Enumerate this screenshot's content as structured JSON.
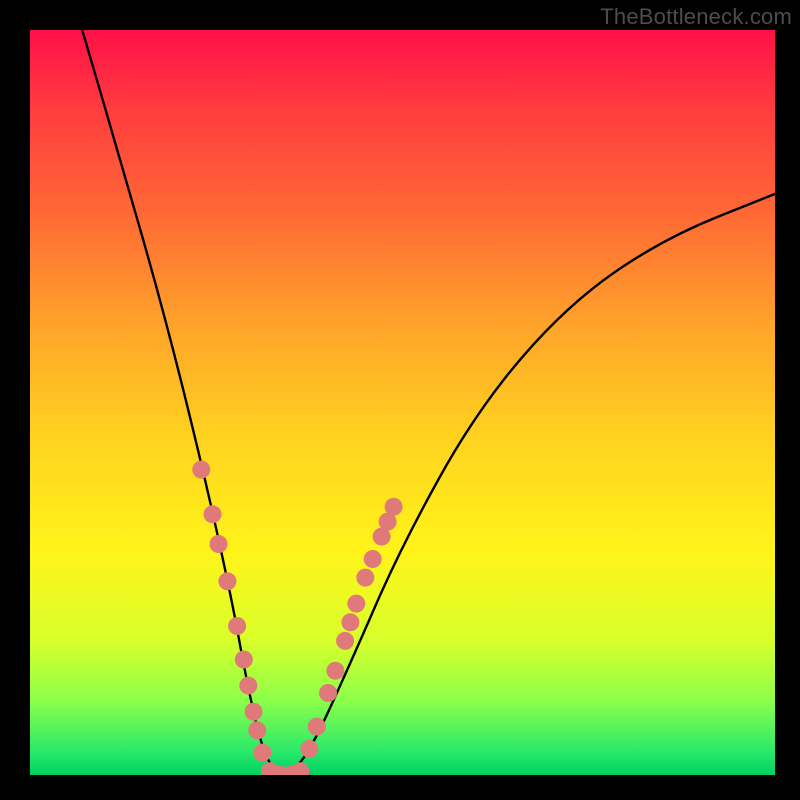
{
  "watermark": "TheBottleneck.com",
  "chart_data": {
    "type": "line",
    "title": "",
    "xlabel": "",
    "ylabel": "",
    "xlim": [
      0,
      100
    ],
    "ylim": [
      0,
      100
    ],
    "series": [
      {
        "name": "bottleneck-curve",
        "x": [
          7,
          12,
          18,
          23,
          27,
          29,
          31,
          33,
          35,
          38,
          43,
          50,
          60,
          72,
          85,
          100
        ],
        "y": [
          100,
          83,
          62,
          42,
          24,
          13,
          4,
          0,
          0,
          4,
          15,
          31,
          49,
          63,
          72,
          78
        ]
      }
    ],
    "markers": {
      "name": "highlight-dots",
      "color": "#e07a7a",
      "points": [
        {
          "x": 23.0,
          "y": 41.0
        },
        {
          "x": 24.5,
          "y": 35.0
        },
        {
          "x": 25.3,
          "y": 31.0
        },
        {
          "x": 26.5,
          "y": 26.0
        },
        {
          "x": 27.8,
          "y": 20.0
        },
        {
          "x": 28.7,
          "y": 15.5
        },
        {
          "x": 29.3,
          "y": 12.0
        },
        {
          "x": 30.0,
          "y": 8.5
        },
        {
          "x": 30.5,
          "y": 6.0
        },
        {
          "x": 31.2,
          "y": 3.0
        },
        {
          "x": 32.2,
          "y": 0.5
        },
        {
          "x": 33.7,
          "y": 0.0
        },
        {
          "x": 35.0,
          "y": 0.0
        },
        {
          "x": 36.3,
          "y": 0.5
        },
        {
          "x": 37.5,
          "y": 3.5
        },
        {
          "x": 38.5,
          "y": 6.5
        },
        {
          "x": 40.0,
          "y": 11.0
        },
        {
          "x": 41.0,
          "y": 14.0
        },
        {
          "x": 42.3,
          "y": 18.0
        },
        {
          "x": 43.0,
          "y": 20.5
        },
        {
          "x": 43.8,
          "y": 23.0
        },
        {
          "x": 45.0,
          "y": 26.5
        },
        {
          "x": 46.0,
          "y": 29.0
        },
        {
          "x": 47.2,
          "y": 32.0
        },
        {
          "x": 48.0,
          "y": 34.0
        },
        {
          "x": 48.8,
          "y": 36.0
        }
      ]
    }
  }
}
